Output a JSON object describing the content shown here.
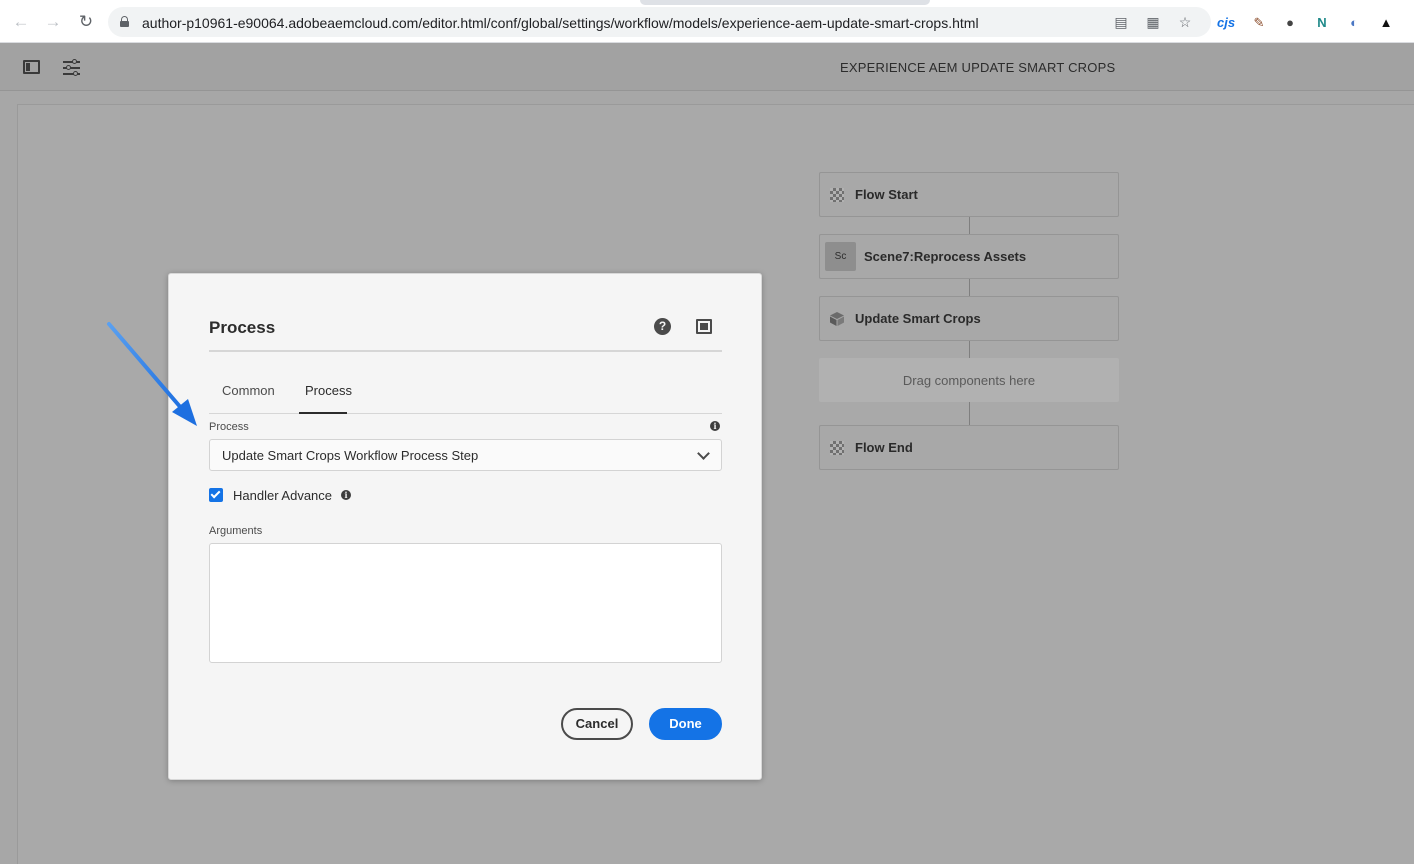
{
  "browser": {
    "url": "author-p10961-e90064.adobeaemcloud.com/editor.html/conf/global/settings/workflow/models/experience-aem-update-smart-crops.html",
    "extensions": [
      "cjs"
    ]
  },
  "toolbar": {
    "page_title": "EXPERIENCE AEM UPDATE SMART CROPS"
  },
  "workflow": {
    "nodes": [
      {
        "label": "Flow Start",
        "icon": "checker-icon"
      },
      {
        "label": "Scene7:Reprocess Assets",
        "icon_text": "Sc"
      },
      {
        "label": "Update Smart Crops",
        "icon": "cube-icon"
      },
      {
        "label": "Flow End",
        "icon": "checker-icon"
      }
    ],
    "drop_zone": "Drag components here"
  },
  "dialog": {
    "title": "Process",
    "tabs": [
      {
        "label": "Common",
        "active": false
      },
      {
        "label": "Process",
        "active": true
      }
    ],
    "process_field": {
      "label": "Process",
      "value": "Update Smart Crops Workflow Process Step"
    },
    "handler_advance": {
      "label": "Handler Advance",
      "checked": true
    },
    "arguments_field": {
      "label": "Arguments",
      "value": ""
    },
    "cancel_label": "Cancel",
    "done_label": "Done"
  },
  "colors": {
    "accent": "#1473e6",
    "annotation_arrow": "#2f7ce8"
  }
}
